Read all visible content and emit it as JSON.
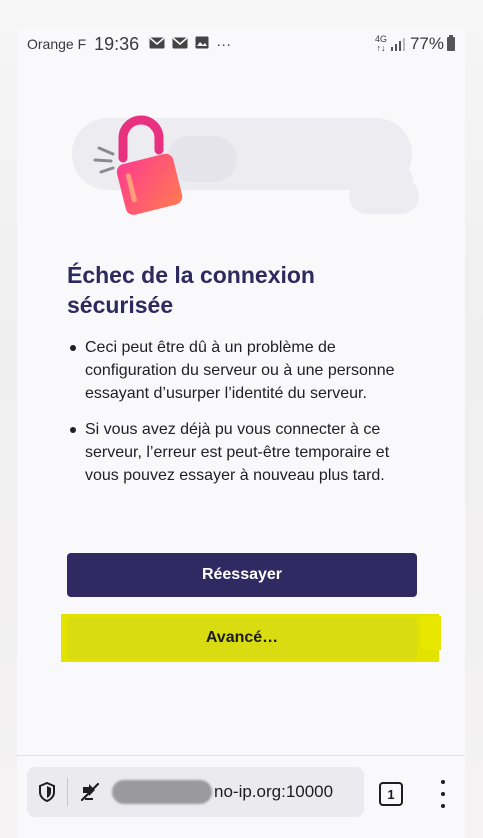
{
  "status_bar": {
    "carrier": "Orange F",
    "time": "19:36",
    "overflow": "···",
    "network_type": "4G",
    "battery": "77%"
  },
  "error_page": {
    "title": "Échec de la connexion sécurisée",
    "bullets": [
      "Ceci peut être dû à un problème de configuration du serveur ou à une personne essayant d’usurper l’identité du serveur.",
      "Si vous avez déjà pu vous connecter à ce serveur, l’erreur est peut-être temporaire et vous pouvez essayer à nouveau plus tard."
    ],
    "retry_label": "Réessayer",
    "advanced_label": "Avancé…"
  },
  "toolbar": {
    "url_visible": "no-ip.org:10000",
    "tab_count": "1"
  },
  "colors": {
    "title": "#2f2a5e",
    "retry_bg": "#312a62",
    "highlight": "#e3e300",
    "lock_gradient": [
      "#ff3b8f",
      "#ff7a52"
    ]
  },
  "icons": [
    "mail-icon",
    "mail-icon",
    "image-icon",
    "lock-broken-icon",
    "shield-icon",
    "tracking-off-icon",
    "menu-dots-icon"
  ]
}
